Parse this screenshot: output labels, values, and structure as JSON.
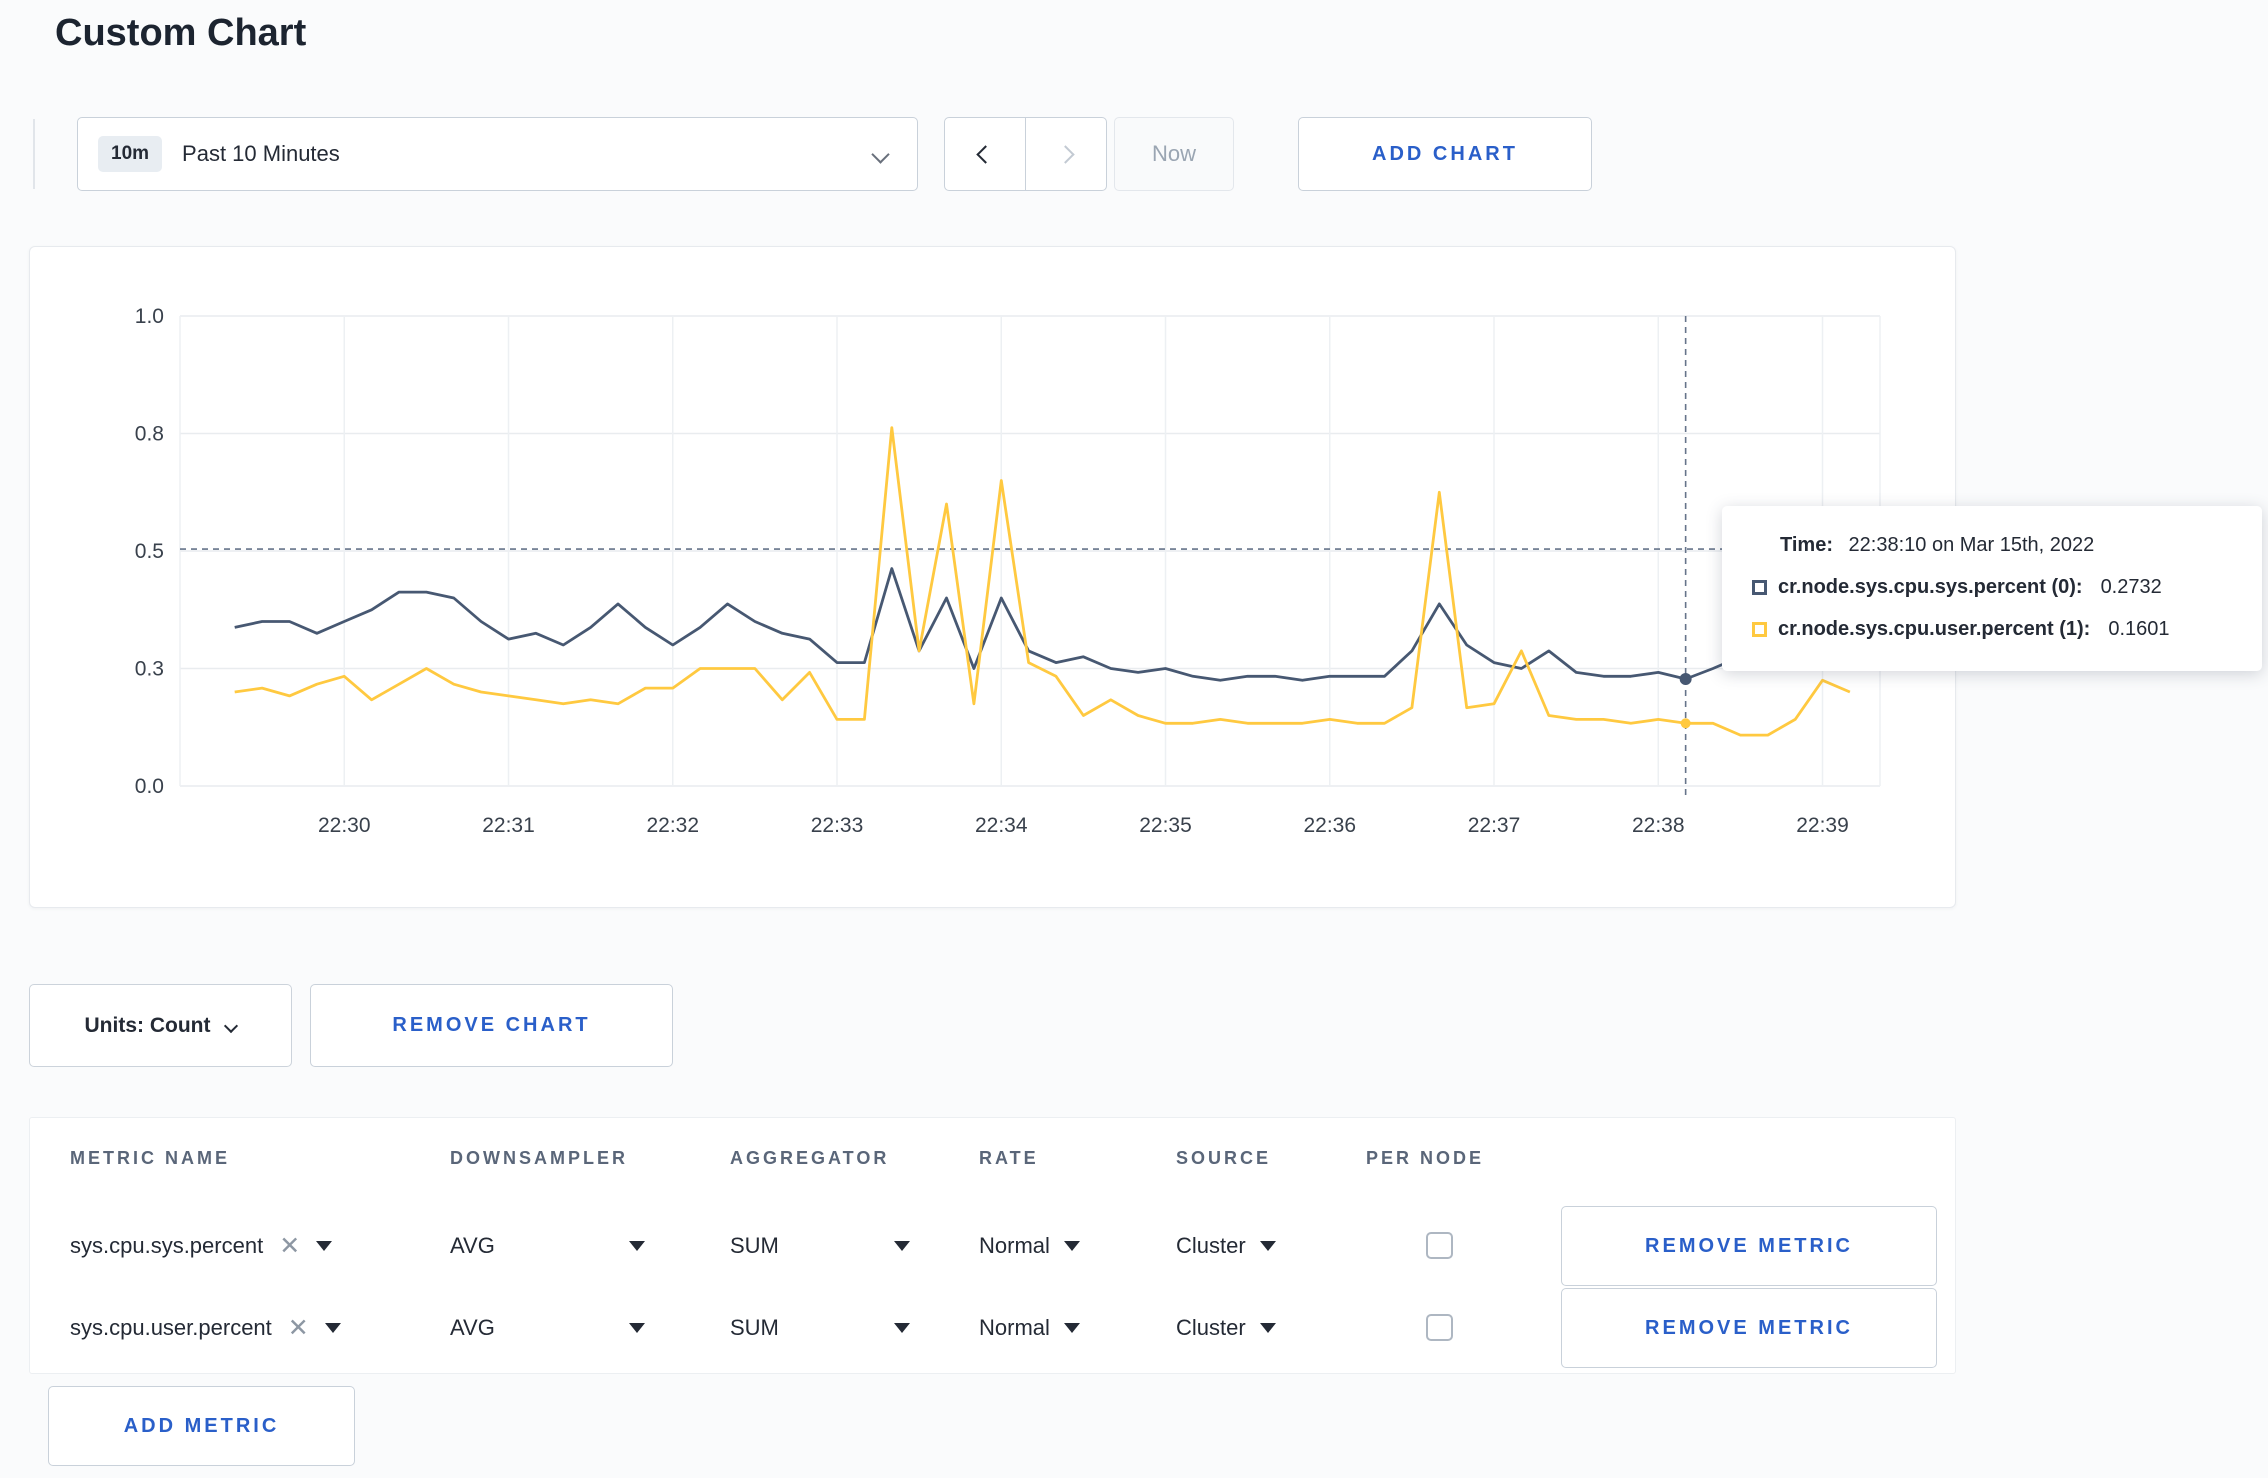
{
  "page": {
    "title": "Custom Chart"
  },
  "colors": {
    "accent": "#2a5fc9",
    "sys_series": "#475872",
    "user_series": "#ffc940",
    "grid": "#e9ecef"
  },
  "toolbar": {
    "range_badge": "10m",
    "range_label": "Past 10 Minutes",
    "now_label": "Now",
    "add_chart_label": "ADD CHART"
  },
  "chart_data": {
    "type": "line",
    "title": "",
    "xlabel": "",
    "ylabel": "",
    "grid": true,
    "x_tick_labels": [
      "22:30",
      "22:31",
      "22:32",
      "22:33",
      "22:34",
      "22:35",
      "22:36",
      "22:37",
      "22:38",
      "22:39"
    ],
    "y_tick_labels": [
      "1.0",
      "0.8",
      "0.5",
      "0.3",
      "0.0"
    ],
    "y_scale_stops": [
      0,
      0.3,
      0.5,
      0.8,
      1.0
    ],
    "x_axis_minutes_range": [
      -1.0,
      9.35
    ],
    "sample_start_min": -0.6667,
    "sample_interval_min": 0.16667,
    "series": [
      {
        "name": "cr.node.sys.cpu.sys.percent",
        "color": "#475872",
        "values": [
          0.37,
          0.38,
          0.38,
          0.36,
          0.38,
          0.4,
          0.43,
          0.43,
          0.42,
          0.38,
          0.35,
          0.36,
          0.34,
          0.37,
          0.41,
          0.37,
          0.34,
          0.37,
          0.41,
          0.38,
          0.36,
          0.35,
          0.31,
          0.31,
          0.47,
          0.33,
          0.42,
          0.3,
          0.42,
          0.33,
          0.31,
          0.32,
          0.3,
          0.29,
          0.3,
          0.28,
          0.27,
          0.28,
          0.28,
          0.27,
          0.28,
          0.28,
          0.28,
          0.33,
          0.41,
          0.34,
          0.31,
          0.3,
          0.33,
          0.29,
          0.28,
          0.28,
          0.29,
          0.2732,
          0.3,
          0.32,
          0.3,
          0.3,
          0.31,
          0.3
        ]
      },
      {
        "name": "cr.node.sys.cpu.user.percent",
        "color": "#ffc940",
        "values": [
          0.24,
          0.25,
          0.23,
          0.26,
          0.28,
          0.22,
          0.26,
          0.3,
          0.26,
          0.24,
          0.23,
          0.22,
          0.21,
          0.22,
          0.21,
          0.25,
          0.25,
          0.3,
          0.3,
          0.3,
          0.22,
          0.29,
          0.17,
          0.17,
          0.81,
          0.33,
          0.62,
          0.21,
          0.68,
          0.31,
          0.28,
          0.18,
          0.22,
          0.18,
          0.16,
          0.16,
          0.17,
          0.16,
          0.16,
          0.16,
          0.17,
          0.16,
          0.16,
          0.2,
          0.65,
          0.2,
          0.21,
          0.33,
          0.18,
          0.17,
          0.17,
          0.16,
          0.17,
          0.1601,
          0.16,
          0.13,
          0.13,
          0.17,
          0.27,
          0.24
        ]
      }
    ],
    "crosshair": {
      "x_min": 8.1667,
      "y_line_value": 0.505,
      "points": [
        {
          "series": 0,
          "value": 0.2732
        },
        {
          "series": 1,
          "value": 0.1601
        }
      ]
    }
  },
  "tooltip": {
    "time_label": "Time:",
    "time_value": "22:38:10 on Mar 15th, 2022",
    "rows": [
      {
        "label": "cr.node.sys.cpu.sys.percent (0):",
        "value": "0.2732",
        "color": "#475872"
      },
      {
        "label": "cr.node.sys.cpu.user.percent (1):",
        "value": "0.1601",
        "color": "#ffc940"
      }
    ]
  },
  "chart_controls": {
    "units_label": "Units: Count",
    "remove_chart_label": "REMOVE CHART"
  },
  "metrics_table": {
    "columns": [
      "METRIC NAME",
      "DOWNSAMPLER",
      "AGGREGATOR",
      "RATE",
      "SOURCE",
      "PER NODE"
    ],
    "rows": [
      {
        "metric": "sys.cpu.sys.percent",
        "downsampler": "AVG",
        "aggregator": "SUM",
        "rate": "Normal",
        "source": "Cluster",
        "per_node_checked": false,
        "remove_label": "REMOVE METRIC"
      },
      {
        "metric": "sys.cpu.user.percent",
        "downsampler": "AVG",
        "aggregator": "SUM",
        "rate": "Normal",
        "source": "Cluster",
        "per_node_checked": false,
        "remove_label": "REMOVE METRIC"
      }
    ],
    "add_metric_label": "ADD METRIC"
  }
}
